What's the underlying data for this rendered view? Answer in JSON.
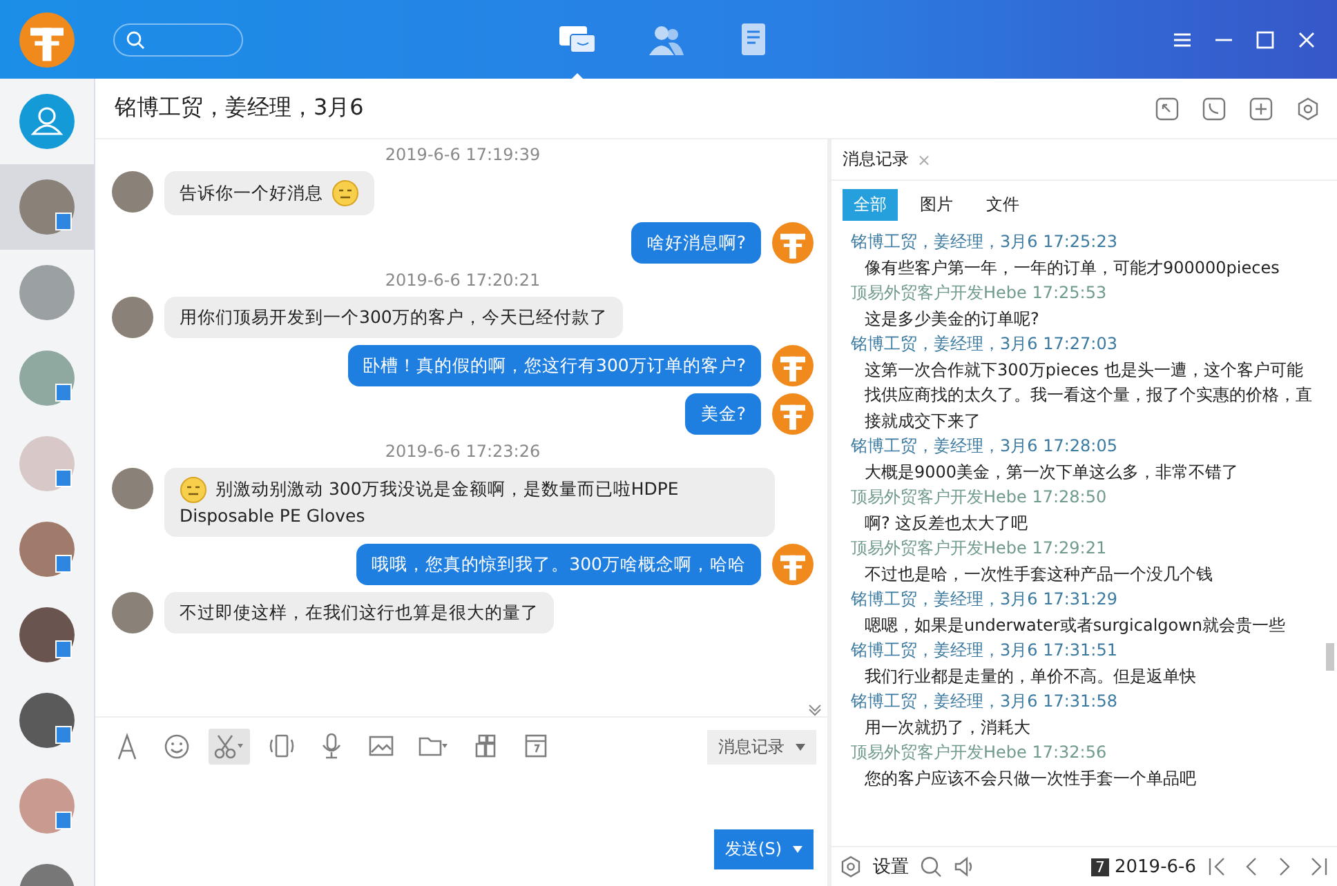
{
  "titlebar": {
    "nav": [
      {
        "kind": "chat",
        "selected": true
      },
      {
        "kind": "contacts",
        "selected": false
      },
      {
        "kind": "notes",
        "selected": false
      }
    ]
  },
  "contacts": [
    {
      "selected": true,
      "mobile": true
    },
    {
      "selected": false,
      "mobile": false
    },
    {
      "selected": false,
      "mobile": true
    },
    {
      "selected": false,
      "mobile": true
    },
    {
      "selected": false,
      "mobile": true
    },
    {
      "selected": false,
      "mobile": true
    },
    {
      "selected": false,
      "mobile": true
    },
    {
      "selected": false,
      "mobile": true
    },
    {
      "selected": false,
      "mobile": false
    }
  ],
  "chat": {
    "title": "铭博工贸，姜经理，3月6",
    "messages": [
      {
        "kind": "time",
        "text": "2019-6-6 17:19:39"
      },
      {
        "kind": "received",
        "text": "告诉你一个好消息",
        "emoji_before": false,
        "emoji_after": true
      },
      {
        "kind": "sent",
        "text": "啥好消息啊?",
        "emoji_before": false,
        "emoji_after": false
      },
      {
        "kind": "time",
        "text": "2019-6-6 17:20:21"
      },
      {
        "kind": "received",
        "text": "用你们顶易开发到一个300万的客户，今天已经付款了",
        "emoji_before": false,
        "emoji_after": false
      },
      {
        "kind": "sent",
        "text": "卧槽！真的假的啊，您这行有300万订单的客户?",
        "emoji_before": false,
        "emoji_after": false
      },
      {
        "kind": "sent",
        "text": "美金?",
        "emoji_before": false,
        "emoji_after": false
      },
      {
        "kind": "time",
        "text": "2019-6-6 17:23:26"
      },
      {
        "kind": "received",
        "text": "别激动别激动 300万我没说是金额啊，是数量而已啦HDPE Disposable PE Gloves",
        "emoji_before": true,
        "emoji_after": false
      },
      {
        "kind": "sent",
        "text": "哦哦，您真的惊到我了。300万啥概念啊，哈哈",
        "emoji_before": false,
        "emoji_after": false
      },
      {
        "kind": "received",
        "text": "不过即使这样，在我们这行也算是很大的量了",
        "emoji_before": false,
        "emoji_after": false
      }
    ],
    "tools": [
      {
        "kind": "font",
        "active": false
      },
      {
        "kind": "smiley",
        "active": false
      },
      {
        "kind": "scissors",
        "active": true
      },
      {
        "kind": "shake",
        "active": false
      },
      {
        "kind": "mic",
        "active": false
      },
      {
        "kind": "image",
        "active": false
      },
      {
        "kind": "folder",
        "active": false
      },
      {
        "kind": "apps",
        "active": false
      },
      {
        "kind": "calendar",
        "active": false
      }
    ],
    "history_button": "消息记录",
    "send_button": "发送(S)"
  },
  "history": {
    "title": "消息记录",
    "close": "×",
    "tabs": [
      {
        "label": "全部",
        "selected": true
      },
      {
        "label": "图片",
        "selected": false
      },
      {
        "label": "文件",
        "selected": false
      }
    ],
    "entries": [
      {
        "kind": "contact",
        "header": "铭博工贸，姜经理，3月6 17:25:23",
        "text": "像有些客户第一年，一年的订单，可能才900000pieces"
      },
      {
        "kind": "self",
        "header": "顶易外贸客户开发Hebe 17:25:53",
        "text": "这是多少美金的订单呢?"
      },
      {
        "kind": "contact",
        "header": "铭博工贸，姜经理，3月6 17:27:03",
        "text": "这第一次合作就下300万pieces 也是头一遭，这个客户可能找供应商找的太久了。我一看这个量，报了个实惠的价格，直接就成交下来了"
      },
      {
        "kind": "contact",
        "header": "铭博工贸，姜经理，3月6 17:28:05",
        "text": "大概是9000美金，第一次下单这么多，非常不错了"
      },
      {
        "kind": "self",
        "header": "顶易外贸客户开发Hebe 17:28:50",
        "text": "啊? 这反差也太大了吧"
      },
      {
        "kind": "self",
        "header": "顶易外贸客户开发Hebe 17:29:21",
        "text": "不过也是哈，一次性手套这种产品一个没几个钱"
      },
      {
        "kind": "contact",
        "header": "铭博工贸，姜经理，3月6 17:31:29",
        "text": "嗯嗯，如果是underwater或者surgicalgown就会贵一些"
      },
      {
        "kind": "contact",
        "header": "铭博工贸，姜经理，3月6 17:31:51",
        "text": "我们行业都是走量的，单价不高。但是返单快"
      },
      {
        "kind": "contact",
        "header": "铭博工贸，姜经理，3月6 17:31:58",
        "text": "用一次就扔了，消耗大"
      },
      {
        "kind": "self",
        "header": "顶易外贸客户开发Hebe 17:32:56",
        "text": "您的客户应该不会只做一次性手套一个单品吧"
      }
    ],
    "settings": "设置",
    "calendar_day": "7",
    "date": "2019-6-6"
  }
}
